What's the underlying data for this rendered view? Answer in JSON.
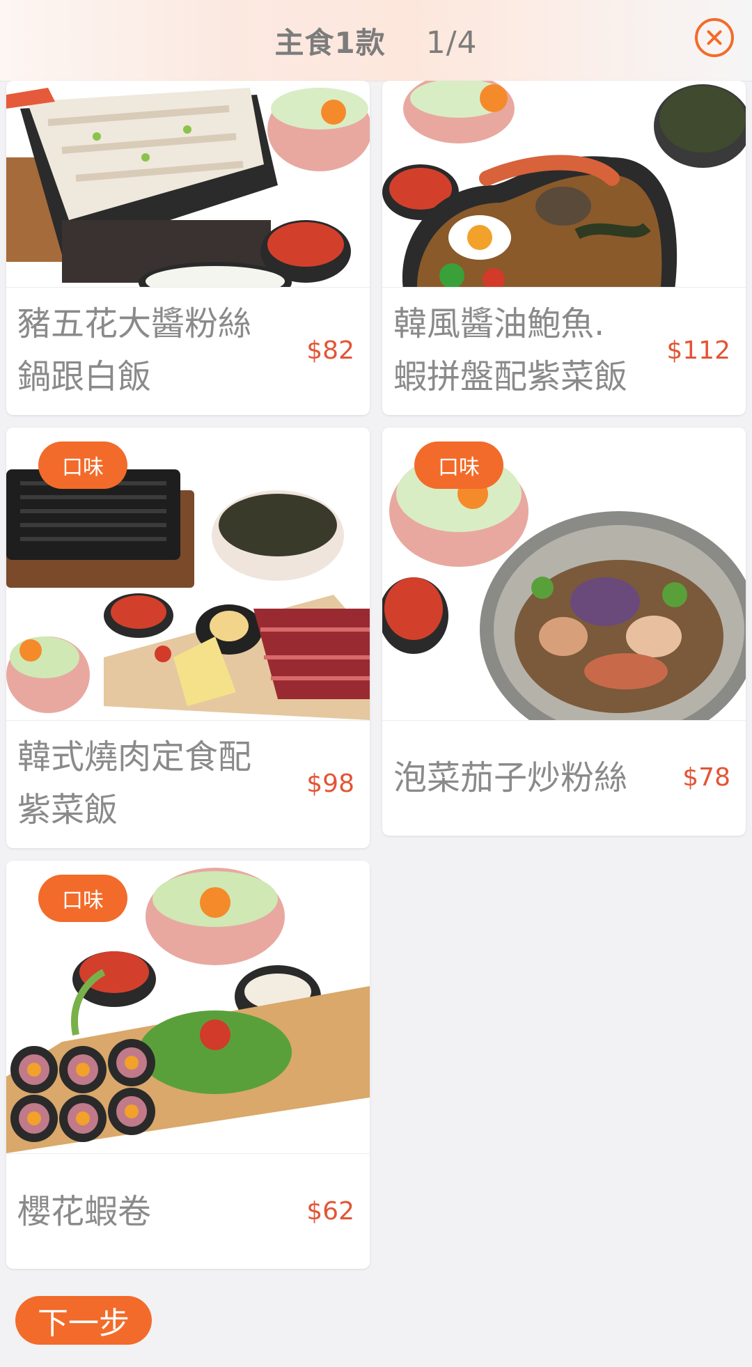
{
  "header": {
    "title": "主食1款",
    "count": "1/4"
  },
  "items": [
    {
      "name_line1": "豬五花大醬粉絲",
      "name_line2": "鍋跟白飯",
      "price": "$82",
      "badge": ""
    },
    {
      "name_line1": "韓風醬油鮑魚.",
      "name_line2": "蝦拼盤配紫菜飯",
      "price": "$112",
      "badge": ""
    },
    {
      "name_line1": "韓式燒肉定食配",
      "name_line2": "紫菜飯",
      "price": "$98",
      "badge": "口味"
    },
    {
      "name_line1": "泡菜茄子炒粉絲",
      "name_line2": "",
      "price": "$78",
      "badge": "口味"
    },
    {
      "name_line1": "櫻花蝦卷",
      "name_line2": "",
      "price": "$62",
      "badge": "口味"
    }
  ],
  "footer": {
    "next_label": "下一步"
  },
  "colors": {
    "accent": "#f26b2a",
    "price": "#e25536",
    "background": "#f2f2f4"
  },
  "icons": {
    "close": "close-circle-icon"
  }
}
